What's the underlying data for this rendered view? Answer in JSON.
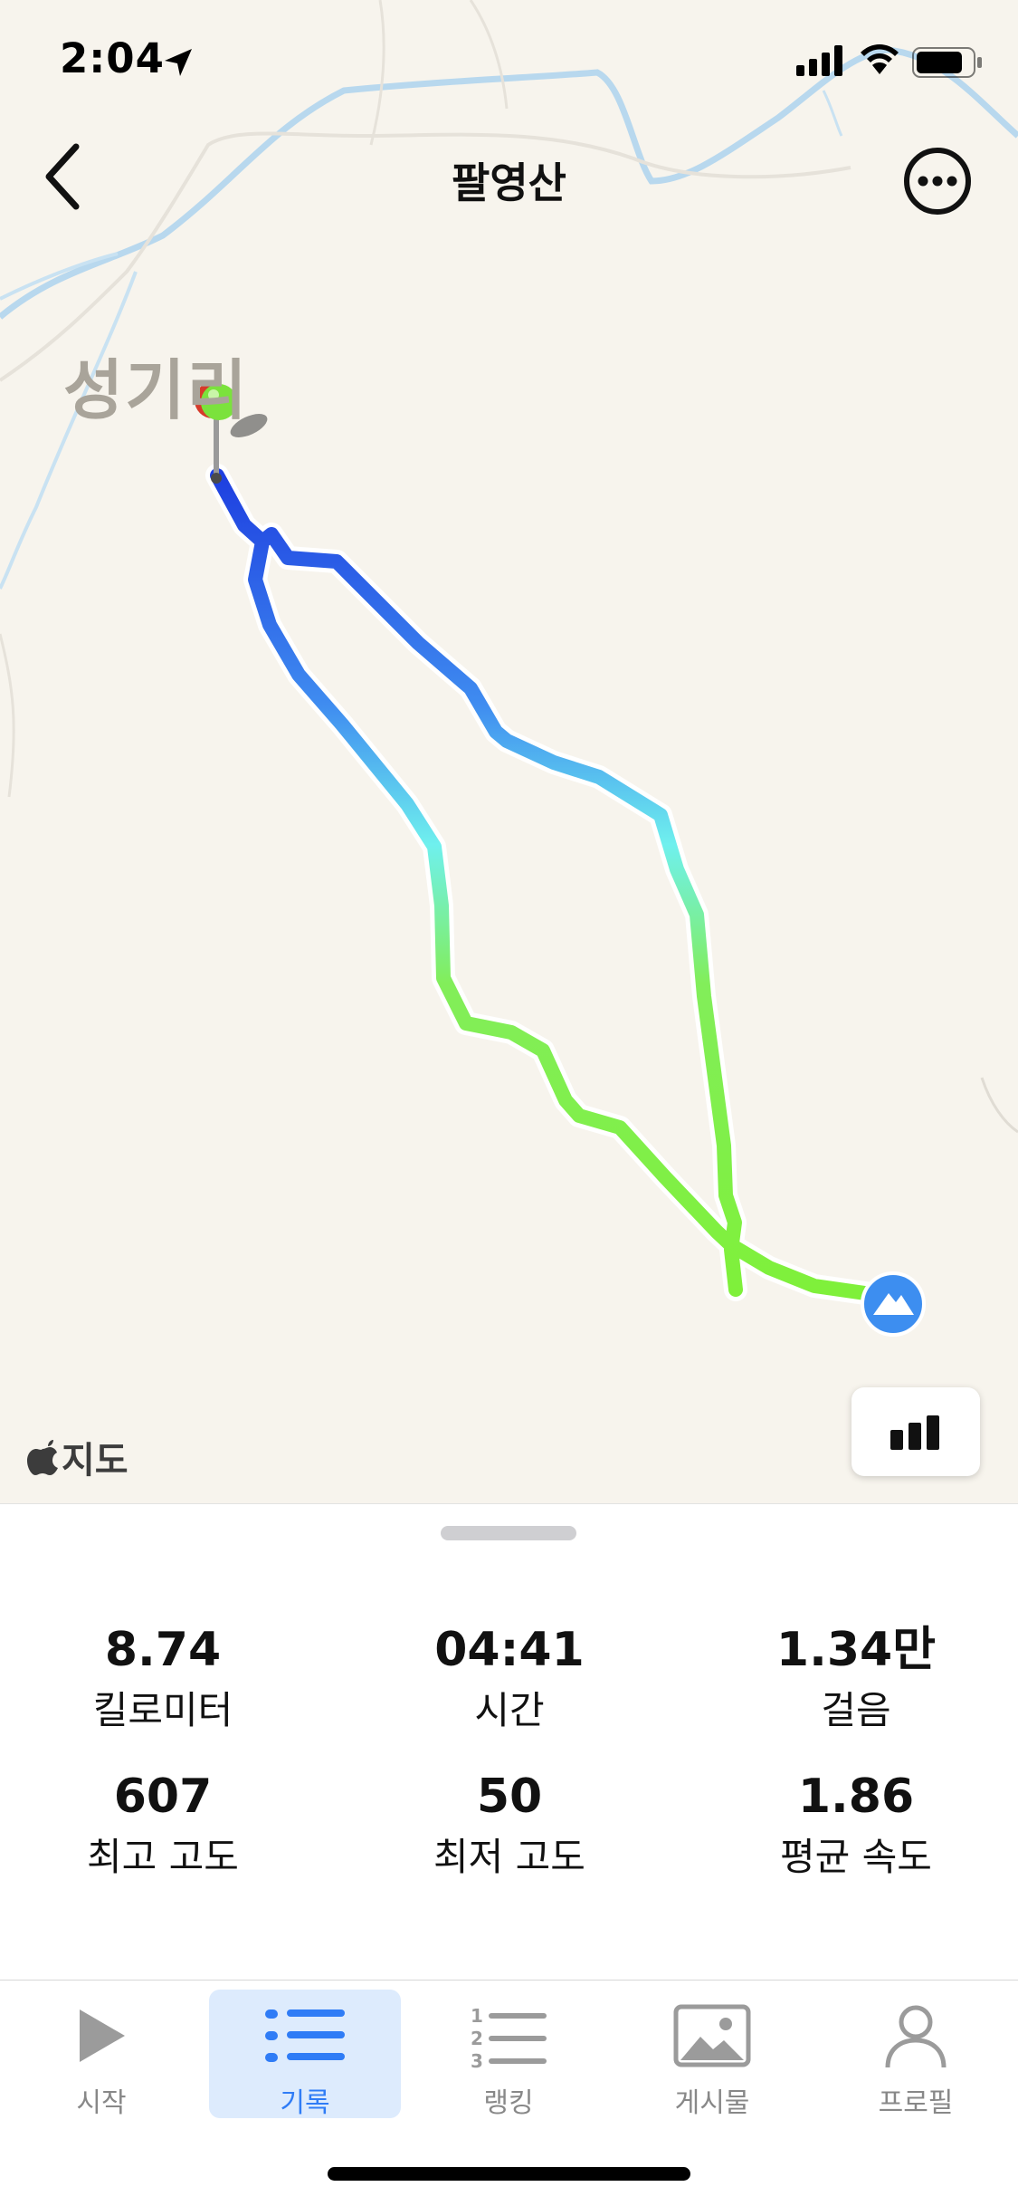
{
  "status_bar": {
    "time": "2:04",
    "icons": [
      "location-arrow-icon",
      "signal-icon",
      "wifi-icon",
      "battery-icon"
    ]
  },
  "header": {
    "title": "팔영산",
    "back_icon": "chevron-left-icon",
    "more_icon": "more-icon"
  },
  "map": {
    "place_label": "성기리",
    "attribution": "지도",
    "route_colors": [
      "#1e3fe0",
      "#4fa3f2",
      "#6ff0ee",
      "#82ee5a",
      "#7ff03a"
    ],
    "start_marker_color": "#7be23c",
    "summit_marker_color": "#3d8ef0",
    "chart_button_icon": "bar-chart-icon"
  },
  "stats": [
    {
      "value": "8.74",
      "label": "킬로미터"
    },
    {
      "value": "04:41",
      "label": "시간"
    },
    {
      "value": "1.34만",
      "label": "걸음"
    },
    {
      "value": "607",
      "label": "최고 고도"
    },
    {
      "value": "50",
      "label": "최저 고도"
    },
    {
      "value": "1.86",
      "label": "평균 속도"
    }
  ],
  "tabs": [
    {
      "label": "시작",
      "icon": "play-icon",
      "active": false
    },
    {
      "label": "기록",
      "icon": "list-icon",
      "active": true
    },
    {
      "label": "랭킹",
      "icon": "ranking-list-icon",
      "active": false
    },
    {
      "label": "게시물",
      "icon": "image-icon",
      "active": false
    },
    {
      "label": "프로필",
      "icon": "profile-icon",
      "active": false
    }
  ],
  "colors": {
    "accent": "#2f7cf6",
    "active_tab_bg": "#ddebfd",
    "map_bg": "#f7f4ed",
    "river": "#b8d8ee"
  }
}
